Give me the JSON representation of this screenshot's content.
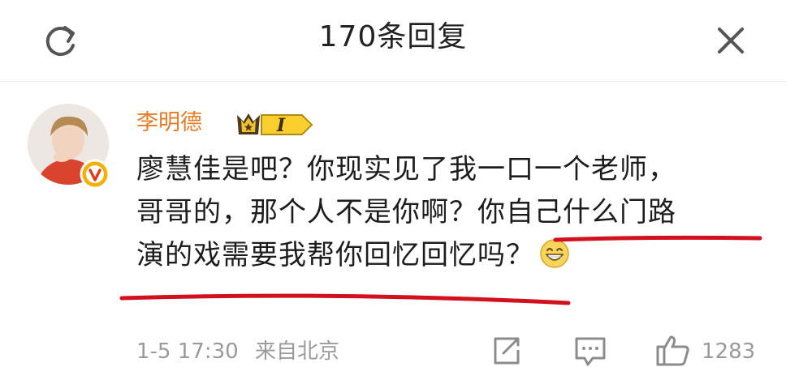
{
  "header": {
    "title": "170条回复",
    "refresh_icon": "refresh-icon",
    "close_icon": "close-icon"
  },
  "comment": {
    "username": "李明德",
    "username_color": "#ea7a22",
    "member_level": "I",
    "verified_icon": "verified-v-icon",
    "lines": [
      "廖慧佳是吧？你现实见了我一口一个老师，",
      "哥哥的，那个人不是你啊？你自己什么门路",
      "演的戏需要我帮你回忆回忆吗？"
    ],
    "emoji": "grin-emoji",
    "underline_color": "#d2101e"
  },
  "footer": {
    "date": "1-5 17:30",
    "source": "来自北京",
    "share_icon": "share-icon",
    "reply_icon": "reply-icon",
    "like_icon": "thumbs-up-icon",
    "like_count": "1283"
  }
}
